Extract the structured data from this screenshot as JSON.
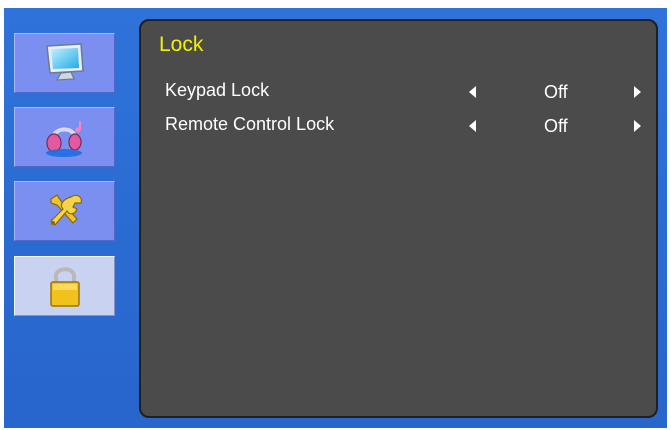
{
  "sidebar": {
    "items": [
      {
        "name": "picture",
        "icon": "monitor-icon",
        "active": false
      },
      {
        "name": "sound",
        "icon": "headphones-icon",
        "active": false
      },
      {
        "name": "setup",
        "icon": "tools-icon",
        "active": false
      },
      {
        "name": "lock",
        "icon": "padlock-icon",
        "active": true
      }
    ]
  },
  "panel": {
    "title": "Lock",
    "rows": [
      {
        "label": "Keypad Lock",
        "value": "Off"
      },
      {
        "label": "Remote Control Lock",
        "value": "Off"
      }
    ]
  },
  "colors": {
    "background_blue": "#2b6fd6",
    "panel_gray": "#4b4b4b",
    "title_yellow": "#f2f200",
    "tab_inactive": "#7b8ff0",
    "tab_active": "#c9d3f1"
  }
}
